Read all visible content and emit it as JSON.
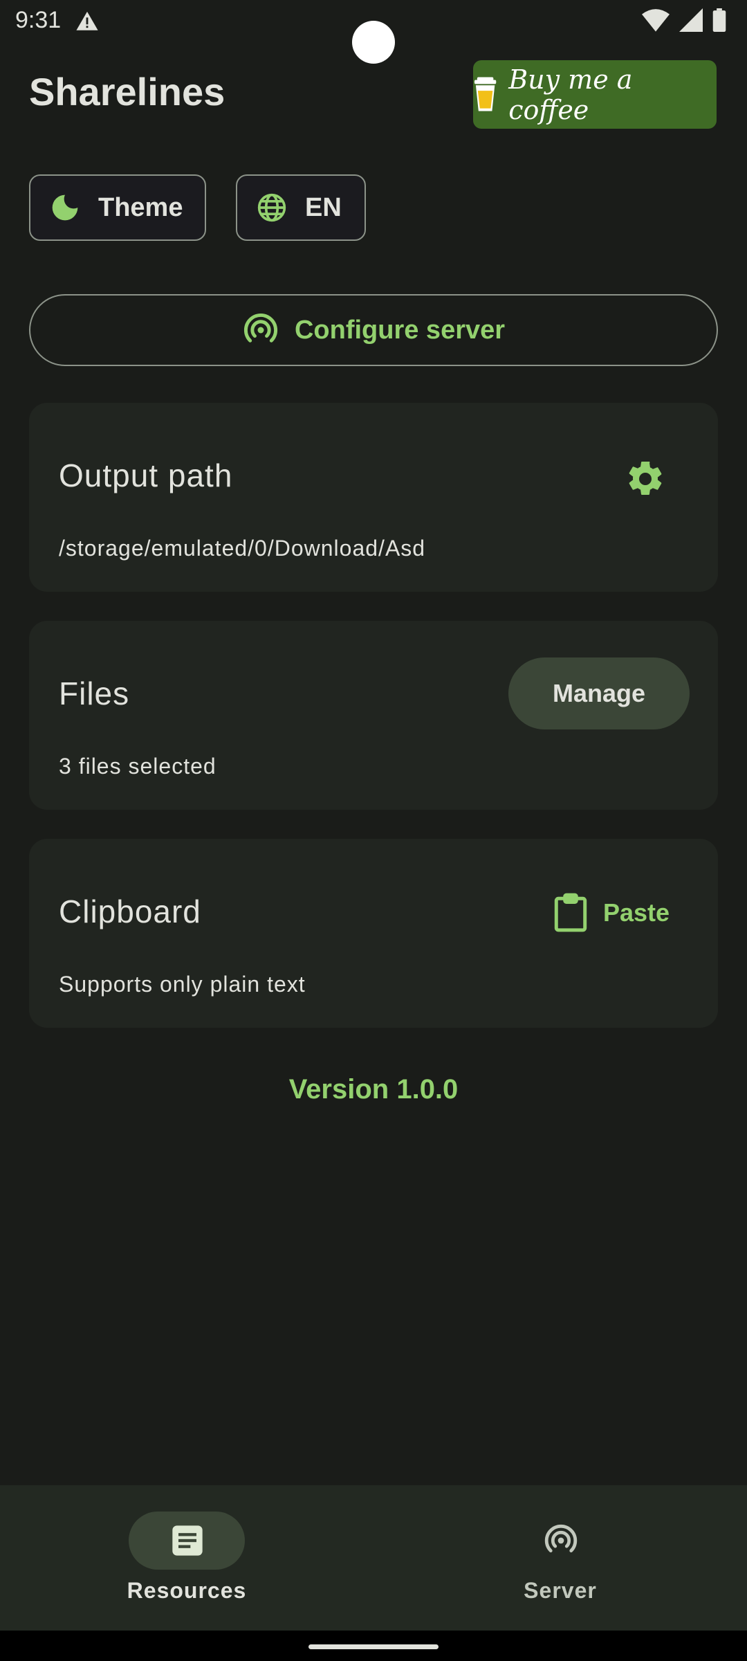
{
  "status": {
    "time": "9:31",
    "icons": [
      "warning-icon",
      "wifi-icon",
      "signal-icon",
      "battery-icon"
    ]
  },
  "header": {
    "title": "Sharelines",
    "coffee_label": "Buy me a coffee"
  },
  "chips": {
    "theme_label": "Theme",
    "language_label": "EN"
  },
  "config": {
    "label": "Configure server"
  },
  "output_card": {
    "title": "Output path",
    "path": "/storage/emulated/0/Download/Asd"
  },
  "files_card": {
    "title": "Files",
    "button": "Manage",
    "subtitle": "3 files selected"
  },
  "clipboard_card": {
    "title": "Clipboard",
    "button": "Paste",
    "subtitle": "Supports only plain text"
  },
  "version": "Version 1.0.0",
  "nav": {
    "items": [
      {
        "label": "Resources",
        "icon": "document-icon",
        "active": true
      },
      {
        "label": "Server",
        "icon": "broadcast-icon",
        "active": false
      }
    ]
  },
  "colors": {
    "background": "#1a1c19",
    "accent": "#93d16e",
    "card": "#212520",
    "coffee": "#3f6b25"
  }
}
